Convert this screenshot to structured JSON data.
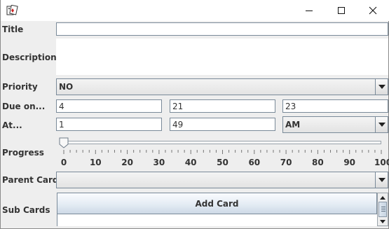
{
  "window": {
    "controls": {
      "minimize": "minimize-icon",
      "maximize": "maximize-icon",
      "close": "close-icon"
    },
    "app_icon": "card-app-icon"
  },
  "form": {
    "title": {
      "label": "Title",
      "value": ""
    },
    "description": {
      "label": "Description",
      "value": ""
    },
    "priority": {
      "label": "Priority",
      "selected": "NO"
    },
    "due_on": {
      "label": "Due on...",
      "day": "4",
      "month": "21",
      "year": "23"
    },
    "at": {
      "label": "At...",
      "hour": "1",
      "minute": "49",
      "ampm": "AM"
    },
    "progress": {
      "label": "Progress",
      "value": 0,
      "min": 0,
      "max": 100,
      "tick_labels": [
        "0",
        "10",
        "20",
        "30",
        "40",
        "50",
        "60",
        "70",
        "80",
        "90",
        "100"
      ]
    },
    "parent_card": {
      "label": "Parent Card",
      "selected": ""
    },
    "sub_cards": {
      "label": "Sub Cards",
      "add_button": "Add Card"
    }
  },
  "colors": {
    "window_bg": "#eeeeee",
    "field_border": "#7a8a99",
    "button_top": "#fafcfe",
    "button_bottom": "#cdd9e6"
  }
}
